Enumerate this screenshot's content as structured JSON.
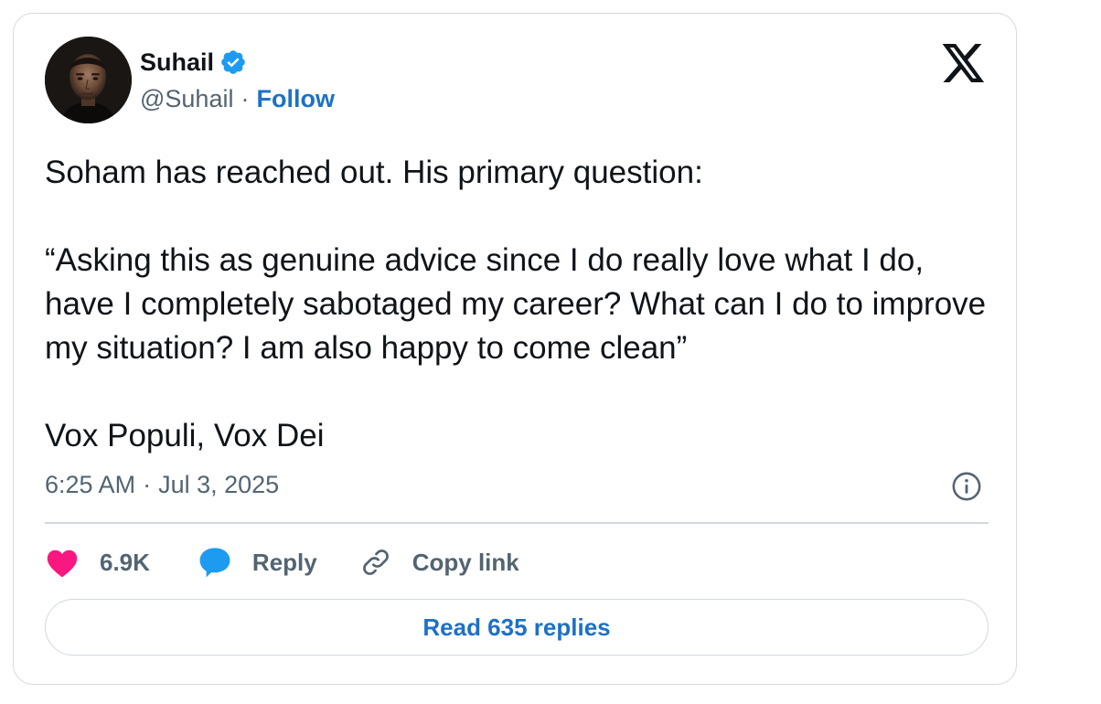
{
  "author": {
    "name": "Suhail",
    "handle": "@Suhail",
    "separator": "·",
    "follow_label": "Follow",
    "verified": true
  },
  "brand_logo": "x-logo-icon",
  "tweet": {
    "text": "Soham has reached out. His primary question:\n\n“Asking this as genuine advice since I do really love what I do, have I completely sabotaged my career? What can I do to improve my situation? I am also happy to come clean”\n\nVox Populi, Vox Dei",
    "time": "6:25 AM",
    "separator": "·",
    "date": "Jul 3, 2025"
  },
  "actions": {
    "like_count": "6.9K",
    "reply_label": "Reply",
    "copy_link_label": "Copy link"
  },
  "read_replies_label": "Read 635 replies",
  "colors": {
    "accent": "#1d71c6",
    "verified": "#1d9bf0",
    "heart": "#f91880",
    "reply_bubble": "#1d9bf0",
    "secondary_text": "#536471"
  }
}
